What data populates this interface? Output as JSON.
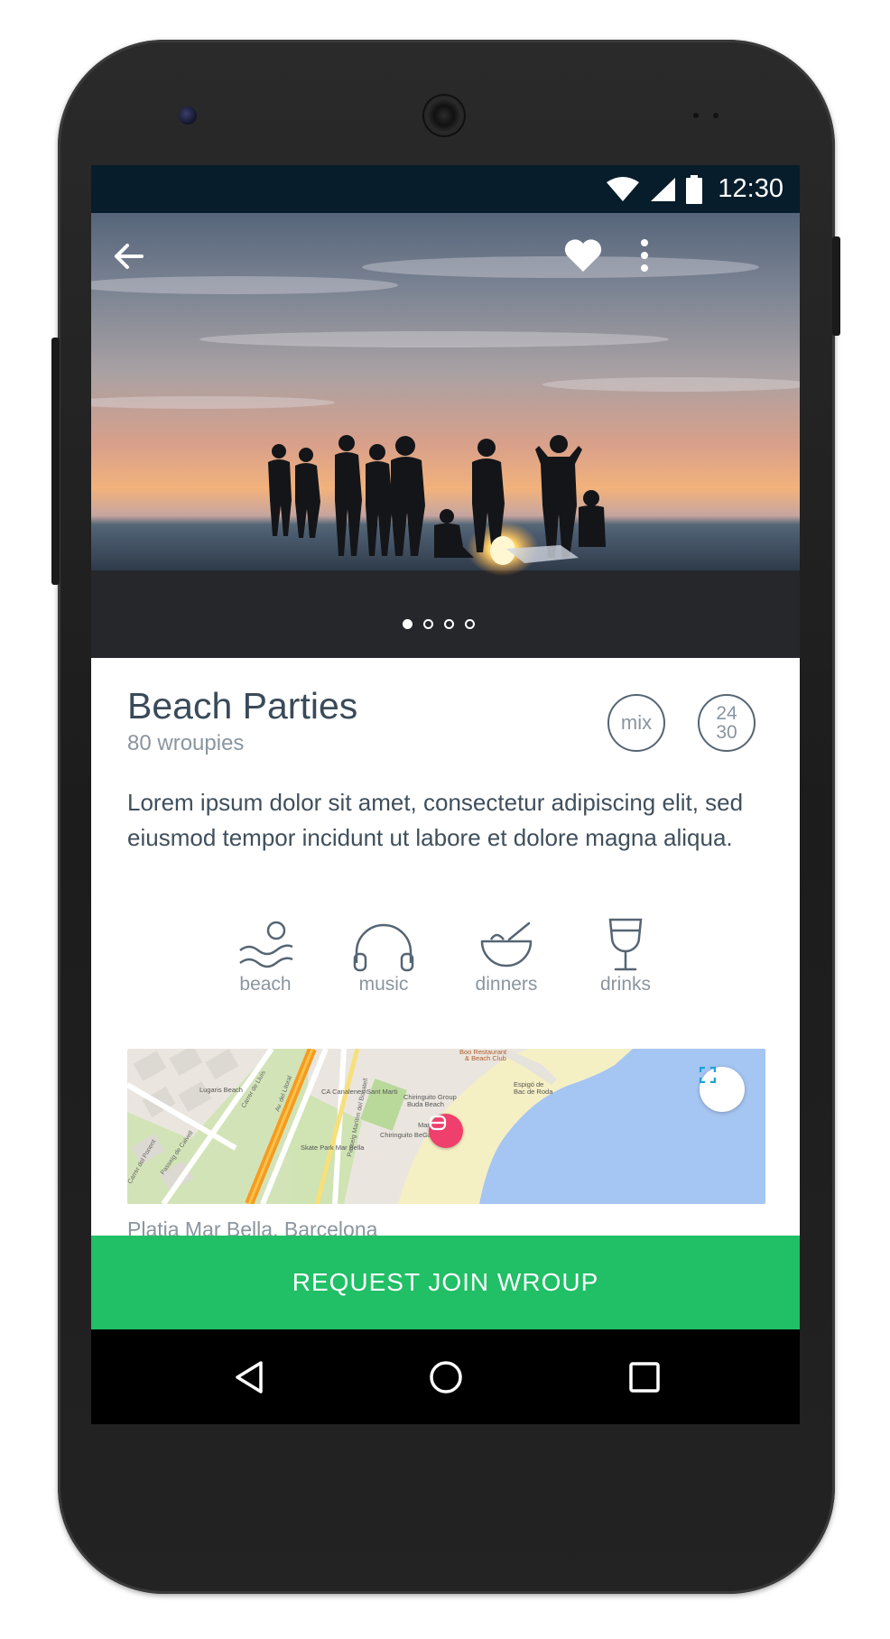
{
  "status_bar": {
    "time": "12:30",
    "icons": [
      "wifi-icon",
      "cell-signal-icon",
      "battery-icon"
    ]
  },
  "hero": {
    "icons": {
      "back": "arrow-left-icon",
      "favorite": "heart-icon",
      "more": "more-vertical-icon"
    },
    "carousel": {
      "total": 4,
      "active_index": 0
    }
  },
  "group": {
    "title": "Beach Parties",
    "member_count": "80 wroupies",
    "gender_badge": "mix",
    "age_range": {
      "min": "24",
      "max": "30"
    },
    "description": "Lorem ipsum dolor sit amet, consectetur adipiscing elit, sed eiusmod tempor incidunt ut labore et dolore magna aliqua."
  },
  "categories": [
    {
      "label": "beach",
      "icon": "beach-icon"
    },
    {
      "label": "music",
      "icon": "headphones-icon"
    },
    {
      "label": "dinners",
      "icon": "bowl-icon"
    },
    {
      "label": "drinks",
      "icon": "wine-glass-icon"
    }
  ],
  "map": {
    "labels": [
      "Lugaris Beach",
      "CA Canalenes Sant Marti",
      "Chiringuito Group Buda Beach",
      "Mar Bella",
      "Chiringuito BeGay",
      "Skate Park Mar Bella",
      "Espigó de Bac de Roda",
      "Boo Restaurant & Beach Club",
      "Passeig de Calvell",
      "Carrer de Lluís",
      "Av. del Litoral",
      "Passeig Marítim del Bogatell",
      "Carrer del Ponent"
    ],
    "address": "Platja Mar Bella, Barcelona"
  },
  "cta": {
    "label": "REQUEST JOIN WROUP"
  },
  "colors": {
    "primary": "#21bf66",
    "status_bar": "#071d2b",
    "text_dark": "#3a4a58",
    "text_muted": "#8a959f",
    "pin": "#ef3f6c"
  }
}
